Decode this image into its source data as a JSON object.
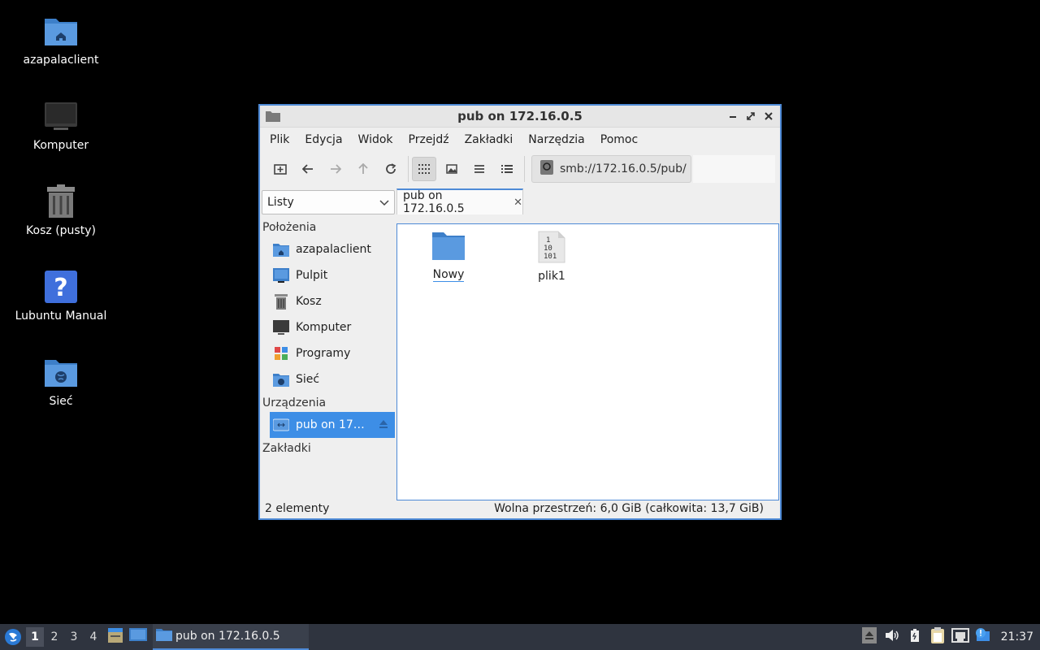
{
  "desktop": {
    "icons": [
      {
        "label": "azapalaclient",
        "icon": "home-folder-icon"
      },
      {
        "label": "Komputer",
        "icon": "computer-icon"
      },
      {
        "label": "Kosz (pusty)",
        "icon": "trash-icon"
      },
      {
        "label": "Lubuntu Manual",
        "icon": "help-icon"
      },
      {
        "label": "Sieć",
        "icon": "network-folder-icon"
      }
    ]
  },
  "window": {
    "title": "pub on 172.16.0.5",
    "menu": [
      "Plik",
      "Edycja",
      "Widok",
      "Przejdź",
      "Zakładki",
      "Narzędzia",
      "Pomoc"
    ],
    "address": "smb://172.16.0.5/pub/",
    "side_pane_mode": "Listy",
    "tab_label": "pub on 172.16.0.5",
    "sidebar": {
      "places_header": "Położenia",
      "places": [
        {
          "label": "azapalaclient",
          "icon": "home-folder-icon"
        },
        {
          "label": "Pulpit",
          "icon": "desktop-icon"
        },
        {
          "label": "Kosz",
          "icon": "trash-icon"
        },
        {
          "label": "Komputer",
          "icon": "computer-icon"
        },
        {
          "label": "Programy",
          "icon": "applications-icon"
        },
        {
          "label": "Sieć",
          "icon": "network-folder-icon"
        }
      ],
      "devices_header": "Urządzenia",
      "devices": [
        {
          "label": "pub on 17…",
          "icon": "network-drive-icon"
        }
      ],
      "bookmarks_header": "Zakładki"
    },
    "files": [
      {
        "name": "Nowy",
        "icon": "folder-icon"
      },
      {
        "name": "plik1",
        "icon": "binary-file-icon"
      }
    ],
    "status": {
      "count": "2 elementy",
      "free_space": "Wolna przestrzeń: 6,0 GiB (całkowita: 13,7 GiB)"
    }
  },
  "taskbar": {
    "workspaces": [
      "1",
      "2",
      "3",
      "4"
    ],
    "active_workspace": "1",
    "task_label": "pub on 172.16.0.5",
    "clock": "21:37"
  },
  "colors": {
    "accent": "#3d8ee6",
    "folder": "#4a90d9",
    "taskbar": "#2f343f"
  }
}
